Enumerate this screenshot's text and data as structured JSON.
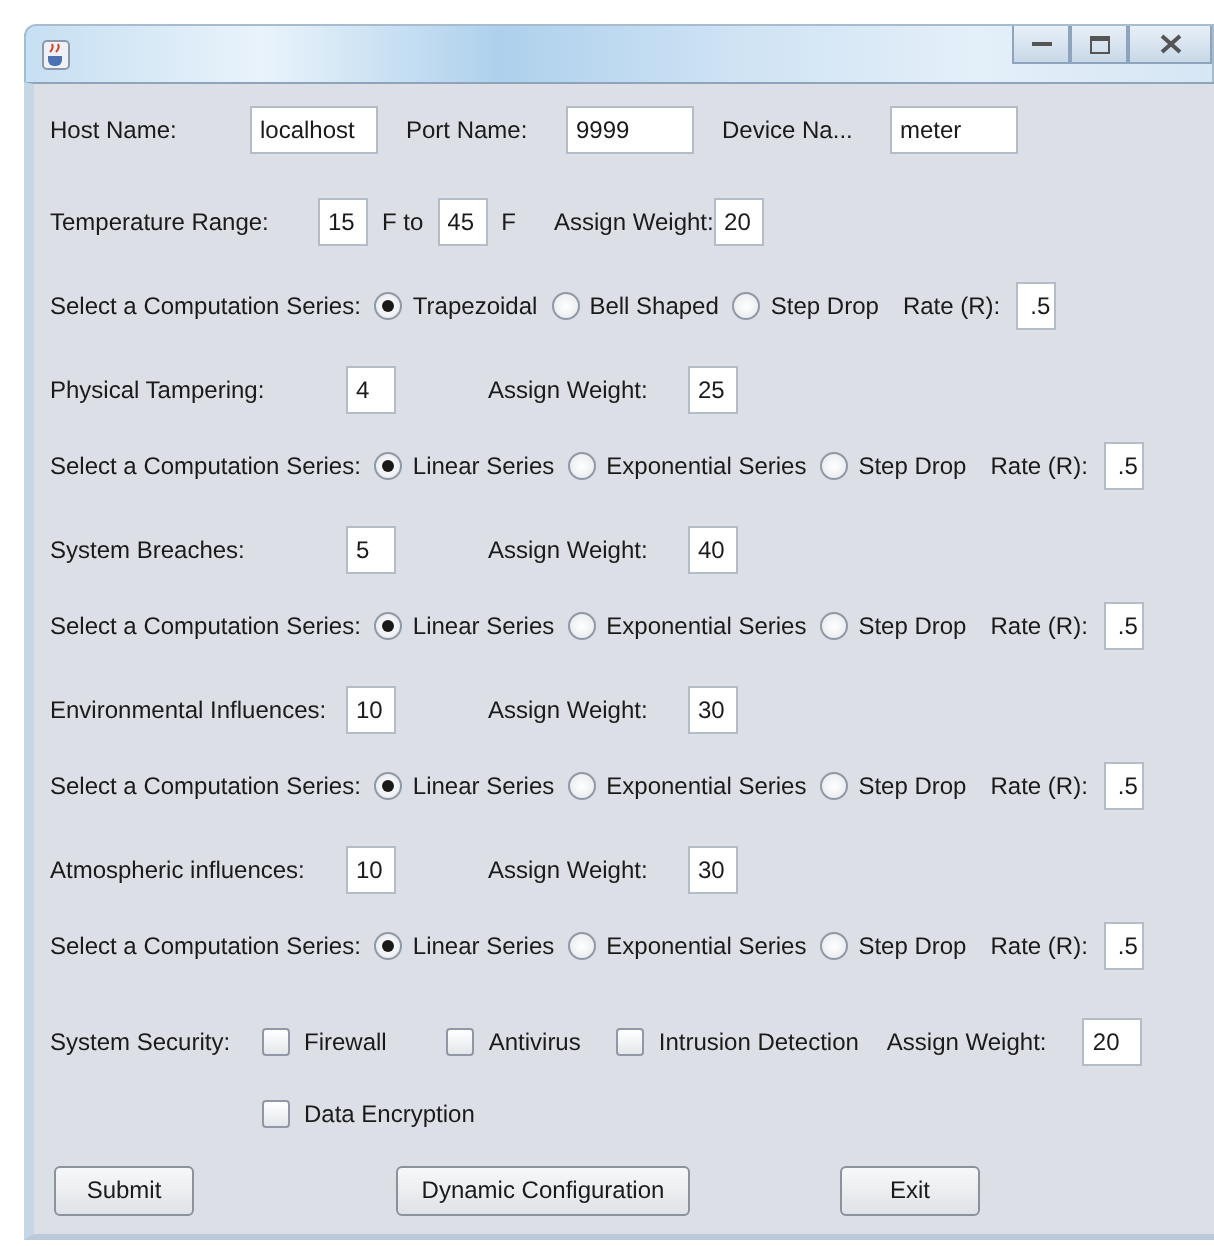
{
  "connection": [
    {
      "label": "Host Name:",
      "value": "localhost"
    },
    {
      "label": "Port Name:",
      "value": "9999"
    },
    {
      "label": "Device Na...",
      "value": "meter"
    }
  ],
  "temperature": {
    "label": "Temperature Range:",
    "from": "15",
    "from_unit": "F to",
    "to": "45",
    "to_unit": "F",
    "weight_label": "Assign Weight:",
    "weight": "20",
    "series": {
      "label": "Select a Computation Series:",
      "options": [
        {
          "label": "Trapezoidal",
          "selected": true
        },
        {
          "label": "Bell Shaped",
          "selected": false
        },
        {
          "label": "Step Drop",
          "selected": false
        }
      ],
      "rate_label": "Rate (R):",
      "rate": ".5"
    }
  },
  "factors": [
    {
      "label": "Physical Tampering:",
      "value": "4",
      "weight_label": "Assign Weight:",
      "weight": "25",
      "series": {
        "label": "Select a Computation Series:",
        "options": [
          {
            "label": "Linear Series",
            "selected": true
          },
          {
            "label": "Exponential Series",
            "selected": false
          },
          {
            "label": "Step Drop",
            "selected": false
          }
        ],
        "rate_label": "Rate (R):",
        "rate": ".5"
      }
    },
    {
      "label": "System Breaches:",
      "value": "5",
      "weight_label": "Assign Weight:",
      "weight": "40",
      "series": {
        "label": "Select a Computation Series:",
        "options": [
          {
            "label": "Linear Series",
            "selected": true
          },
          {
            "label": "Exponential Series",
            "selected": false
          },
          {
            "label": "Step Drop",
            "selected": false
          }
        ],
        "rate_label": "Rate (R):",
        "rate": ".5"
      }
    },
    {
      "label": "Environmental Influences:",
      "value": "10",
      "weight_label": "Assign Weight:",
      "weight": "30",
      "series": {
        "label": "Select a Computation Series:",
        "options": [
          {
            "label": "Linear Series",
            "selected": true
          },
          {
            "label": "Exponential Series",
            "selected": false
          },
          {
            "label": "Step Drop",
            "selected": false
          }
        ],
        "rate_label": "Rate (R):",
        "rate": ".5"
      }
    },
    {
      "label": "Atmospheric influences:",
      "value": "10",
      "weight_label": "Assign Weight:",
      "weight": "30",
      "series": {
        "label": "Select a Computation Series:",
        "options": [
          {
            "label": "Linear Series",
            "selected": true
          },
          {
            "label": "Exponential Series",
            "selected": false
          },
          {
            "label": "Step Drop",
            "selected": false
          }
        ],
        "rate_label": "Rate (R):",
        "rate": ".5"
      }
    }
  ],
  "security": {
    "label": "System Security:",
    "options": [
      {
        "label": "Firewall",
        "checked": false
      },
      {
        "label": "Antivirus",
        "checked": false
      },
      {
        "label": "Intrusion Detection",
        "checked": false
      },
      {
        "label": "Data Encryption",
        "checked": false
      }
    ],
    "weight_label": "Assign Weight:",
    "weight": "20"
  },
  "buttons": [
    "Submit",
    "Dynamic Configuration",
    "Exit"
  ]
}
